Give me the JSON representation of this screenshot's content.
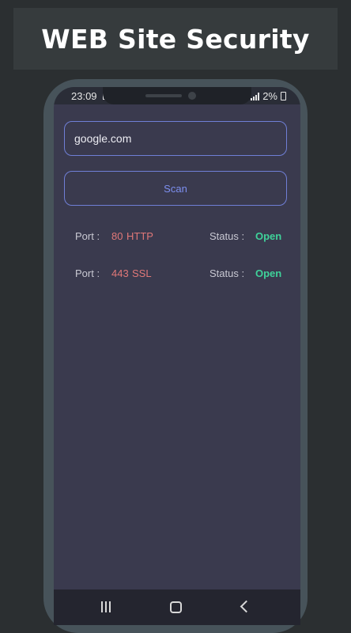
{
  "banner": {
    "title": "WEB Site Security"
  },
  "status_bar": {
    "time": "23:09",
    "battery": "2%"
  },
  "scan_form": {
    "url_value": "google.com",
    "scan_label": "Scan"
  },
  "results": [
    {
      "port_label": "Port :",
      "port_number": "80",
      "service": "HTTP",
      "status_label": "Status :",
      "status_value": "Open"
    },
    {
      "port_label": "Port :",
      "port_number": "443",
      "service": "SSL",
      "status_label": "Status :",
      "status_value": "Open"
    }
  ],
  "colors": {
    "background": "#2b2f31",
    "screen": "#3a3a4e",
    "accent": "#6f7fd6",
    "port": "#e07878",
    "status_open": "#3fd29a"
  },
  "icons": {
    "nav": [
      "recent-apps-icon",
      "home-icon",
      "back-icon"
    ]
  }
}
